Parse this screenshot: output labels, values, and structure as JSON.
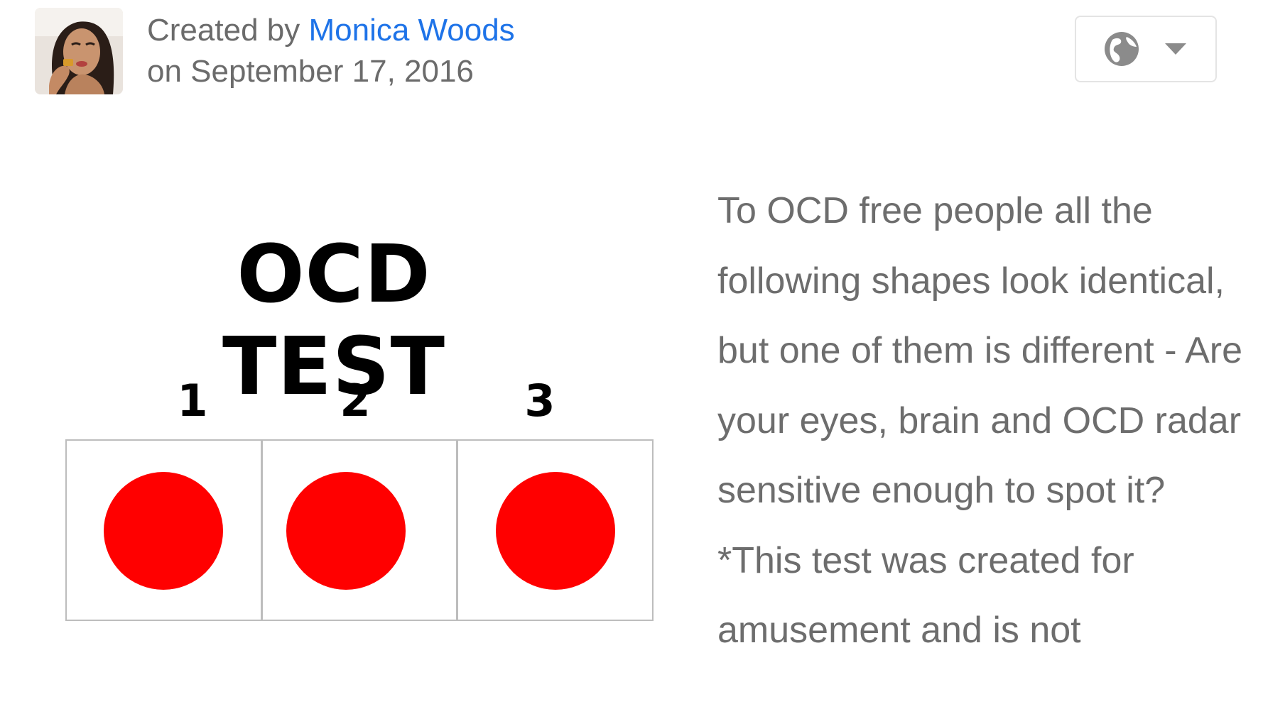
{
  "post": {
    "created_by_label": "Created by",
    "author_name": "Monica Woods",
    "date_line": "on September 17, 2016",
    "avatar_alt": "Monica Woods avatar",
    "privacy_icon": "globe-icon",
    "dropdown_icon": "caret-down-icon"
  },
  "quiz_image": {
    "title": "OCD TEST",
    "options": [
      {
        "label": "1",
        "color": "#ff0000"
      },
      {
        "label": "2",
        "color": "#ff0000"
      },
      {
        "label": "3",
        "color": "#ff0000"
      }
    ]
  },
  "description": {
    "text": "To OCD free people all the following shapes look identical, but one of them is different - Are your eyes, brain and OCD radar sensitive enough to spot it? *This test was created for amusement and is not"
  },
  "colors": {
    "link": "#1e73e8",
    "meta_text": "#6b6b6b",
    "body_text": "#6d6d6d",
    "shape": "#ff0000"
  }
}
